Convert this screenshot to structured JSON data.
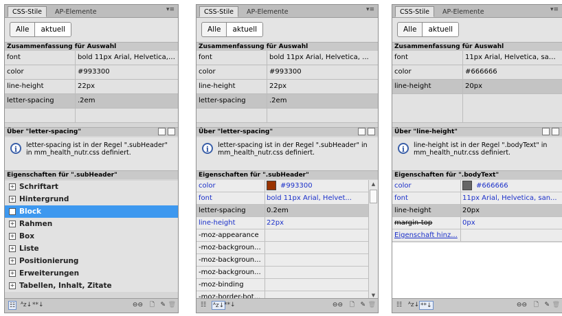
{
  "tabs": {
    "css": "CSS-Stile",
    "ap": "AP-Elemente",
    "menu": "▾≡"
  },
  "buttons": {
    "all": "Alle",
    "current": "aktuell"
  },
  "summary_title": "Zusammenfassung für Auswahl",
  "toolbar": {
    "list": "☷",
    "az": "ᴬz↓",
    "set": "**↓",
    "link": "⊖⊖",
    "new": "🗋",
    "edit": "✎",
    "delete": "🗑"
  },
  "panels": [
    {
      "summary": [
        {
          "k": "font",
          "v": "bold 11px Arial, Helvetica, ..."
        },
        {
          "k": "color",
          "v": "#993300"
        },
        {
          "k": "line-height",
          "v": "22px"
        },
        {
          "k": "letter-spacing",
          "v": ".2em"
        }
      ],
      "about_title": "Über \"letter-spacing\"",
      "info": "letter-spacing ist in der Regel \".subHeader\" in mm_health_nutr.css definiert.",
      "props_title": "Eigenschaften für \".subHeader\"",
      "categories": [
        "Schriftart",
        "Hintergrund",
        "Block",
        "Rahmen",
        "Box",
        "Liste",
        "Positionierung",
        "Erweiterungen",
        "Tabellen, Inhalt, Zitate"
      ]
    },
    {
      "summary": [
        {
          "k": "font",
          "v": "bold 11px Arial, Helvetica, ..."
        },
        {
          "k": "color",
          "v": "#993300"
        },
        {
          "k": "line-height",
          "v": "22px"
        },
        {
          "k": "letter-spacing",
          "v": ".2em"
        }
      ],
      "about_title": "Über \"letter-spacing\"",
      "info": "letter-spacing ist in der Regel \".subHeader\" in mm_health_nutr.css definiert.",
      "props_title": "Eigenschaften für \".subHeader\"",
      "props": [
        {
          "k": "color",
          "v": "#993300",
          "swatch": "#993300"
        },
        {
          "k": "font",
          "v": "bold 11px Arial, Helvet..."
        },
        {
          "k": "letter-spacing",
          "v": "0.2em"
        },
        {
          "k": "line-height",
          "v": "22px"
        },
        {
          "k": "-moz-appearance",
          "v": ""
        },
        {
          "k": "-moz-backgroun...",
          "v": ""
        },
        {
          "k": "-moz-backgroun...",
          "v": ""
        },
        {
          "k": "-moz-backgroun...",
          "v": ""
        },
        {
          "k": "-moz-binding",
          "v": ""
        },
        {
          "k": "-moz-border-bot...",
          "v": ""
        }
      ]
    },
    {
      "summary": [
        {
          "k": "font",
          "v": "11px Arial, Helvetica, san..."
        },
        {
          "k": "color",
          "v": "#666666"
        },
        {
          "k": "line-height",
          "v": "20px"
        }
      ],
      "about_title": "Über \"line-height\"",
      "info": "line-height ist in der Regel \".bodyText\" in mm_health_nutr.css definiert.",
      "props_title": "Eigenschaften für \".bodyText\"",
      "props": [
        {
          "k": "color",
          "v": "#666666",
          "swatch": "#666666"
        },
        {
          "k": "font",
          "v": "11px Arial, Helvetica, san..."
        },
        {
          "k": "line-height",
          "v": "20px"
        },
        {
          "k": "margin-top",
          "v": "0px"
        }
      ],
      "add_link": "Eigenschaft hinz..."
    }
  ]
}
